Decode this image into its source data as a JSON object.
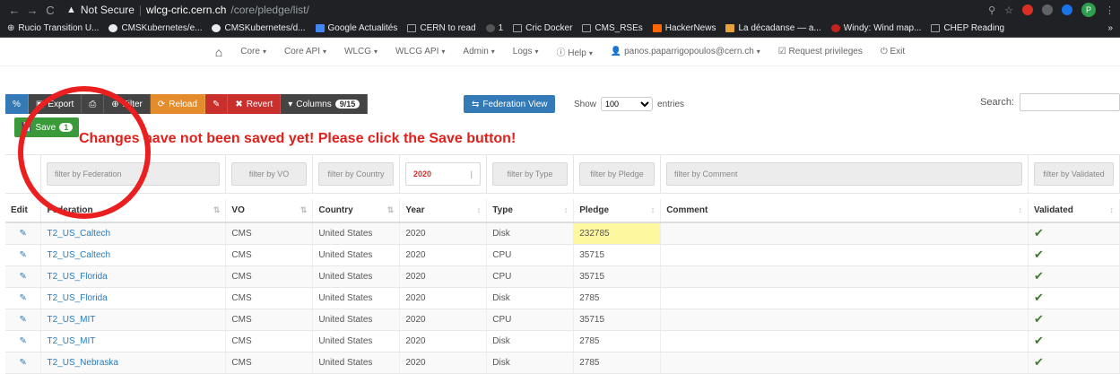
{
  "browser": {
    "not_secure": "Not Secure",
    "host": "wlcg-cric.cern.ch",
    "path": "/core/pledge/list/",
    "avatar": "P"
  },
  "bookmarks": [
    "Rucio Transition U...",
    "CMSKubernetes/e...",
    "CMSKubernetes/d...",
    "Google Actualités",
    "CERN to read",
    "1",
    "Cric Docker",
    "CMS_RSEs",
    "HackerNews",
    "La décadanse — a...",
    "Windy: Wind map...",
    "CHEP Reading"
  ],
  "appnav": {
    "items": [
      "Core",
      "Core API",
      "WLCG",
      "WLCG API",
      "Admin",
      "Logs",
      "Help"
    ],
    "user": "panos.paparrigopoulos@cern.ch",
    "request": "Request privileges",
    "exit": "Exit"
  },
  "toolbar": {
    "export": "Export",
    "filter": "Filter",
    "reload": "Reload",
    "revert": "Revert",
    "columns": "Columns",
    "columns_badge": "9/15",
    "federation_view": "Federation View",
    "show": "Show",
    "show_value": "100",
    "entries": "entries",
    "search": "Search:",
    "save": "Save",
    "save_badge": "1"
  },
  "warning": "Changes have not been saved yet! Please click the Save button!",
  "filters": {
    "federation": "filter by Federation",
    "vo": "filter by VO",
    "country": "filter by Country",
    "year": "2020",
    "type": "filter by Type",
    "pledge": "filter by Pledge",
    "comment": "filter by Comment",
    "validated": "filter by Validated"
  },
  "columns": [
    "Edit",
    "Federation",
    "VO",
    "Country",
    "Year",
    "Type",
    "Pledge",
    "Comment",
    "Validated"
  ],
  "rows": [
    {
      "federation": "T2_US_Caltech",
      "vo": "CMS",
      "country": "United States",
      "year": "2020",
      "type": "Disk",
      "pledge": "232785",
      "comment": "",
      "validated": "✔"
    },
    {
      "federation": "T2_US_Caltech",
      "vo": "CMS",
      "country": "United States",
      "year": "2020",
      "type": "CPU",
      "pledge": "35715",
      "comment": "",
      "validated": "✔"
    },
    {
      "federation": "T2_US_Florida",
      "vo": "CMS",
      "country": "United States",
      "year": "2020",
      "type": "CPU",
      "pledge": "35715",
      "comment": "",
      "validated": "✔"
    },
    {
      "federation": "T2_US_Florida",
      "vo": "CMS",
      "country": "United States",
      "year": "2020",
      "type": "Disk",
      "pledge": "2785",
      "comment": "",
      "validated": "✔"
    },
    {
      "federation": "T2_US_MIT",
      "vo": "CMS",
      "country": "United States",
      "year": "2020",
      "type": "CPU",
      "pledge": "35715",
      "comment": "",
      "validated": "✔"
    },
    {
      "federation": "T2_US_MIT",
      "vo": "CMS",
      "country": "United States",
      "year": "2020",
      "type": "Disk",
      "pledge": "2785",
      "comment": "",
      "validated": "✔"
    },
    {
      "federation": "T2_US_Nebraska",
      "vo": "CMS",
      "country": "United States",
      "year": "2020",
      "type": "Disk",
      "pledge": "2785",
      "comment": "",
      "validated": "✔"
    }
  ]
}
